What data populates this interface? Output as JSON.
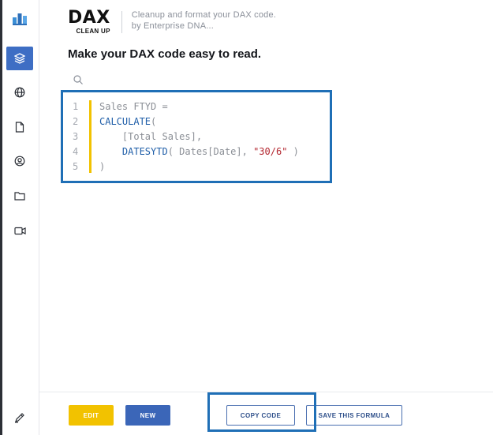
{
  "sidebar": {
    "items": [
      {
        "name": "logo",
        "icon": "bar-chart-logo-icon"
      },
      {
        "name": "layers",
        "icon": "layers-icon",
        "active": true
      },
      {
        "name": "globe",
        "icon": "globe-icon"
      },
      {
        "name": "document",
        "icon": "document-icon"
      },
      {
        "name": "profile",
        "icon": "user-circle-icon"
      },
      {
        "name": "folder",
        "icon": "folder-icon"
      },
      {
        "name": "video",
        "icon": "video-icon"
      },
      {
        "name": "tools",
        "icon": "pencil-ruler-icon"
      }
    ],
    "accent_color": "#3e6ec4"
  },
  "header": {
    "logo_main": "DAX",
    "logo_sub": "CLEAN UP",
    "tagline_line1": "Cleanup and format your DAX code.",
    "tagline_line2": "by Enterprise DNA..."
  },
  "main": {
    "title": "Make your DAX code easy to read.",
    "search_icon": "search-icon",
    "code": {
      "line_numbers": [
        "1",
        "2",
        "3",
        "4",
        "5"
      ],
      "line1": "Sales FTYD =",
      "line2_fn": "CALCULATE",
      "line2_rest": "(",
      "line3": "    [Total Sales],",
      "line4_indent": "    ",
      "line4_fn": "DATESYTD",
      "line4_mid": "( Dates[Date], ",
      "line4_str": "\"30/6\"",
      "line4_end": " )",
      "line5": ")",
      "bar_color": "#f2c200"
    }
  },
  "actions": {
    "edit_label": "EDIT",
    "new_label": "NEW",
    "copy_label": "COPY CODE",
    "save_label": "SAVE THIS FORMULA"
  },
  "colors": {
    "highlight": "#1f6fb6",
    "edit": "#f2c200",
    "new": "#3b66b8"
  }
}
